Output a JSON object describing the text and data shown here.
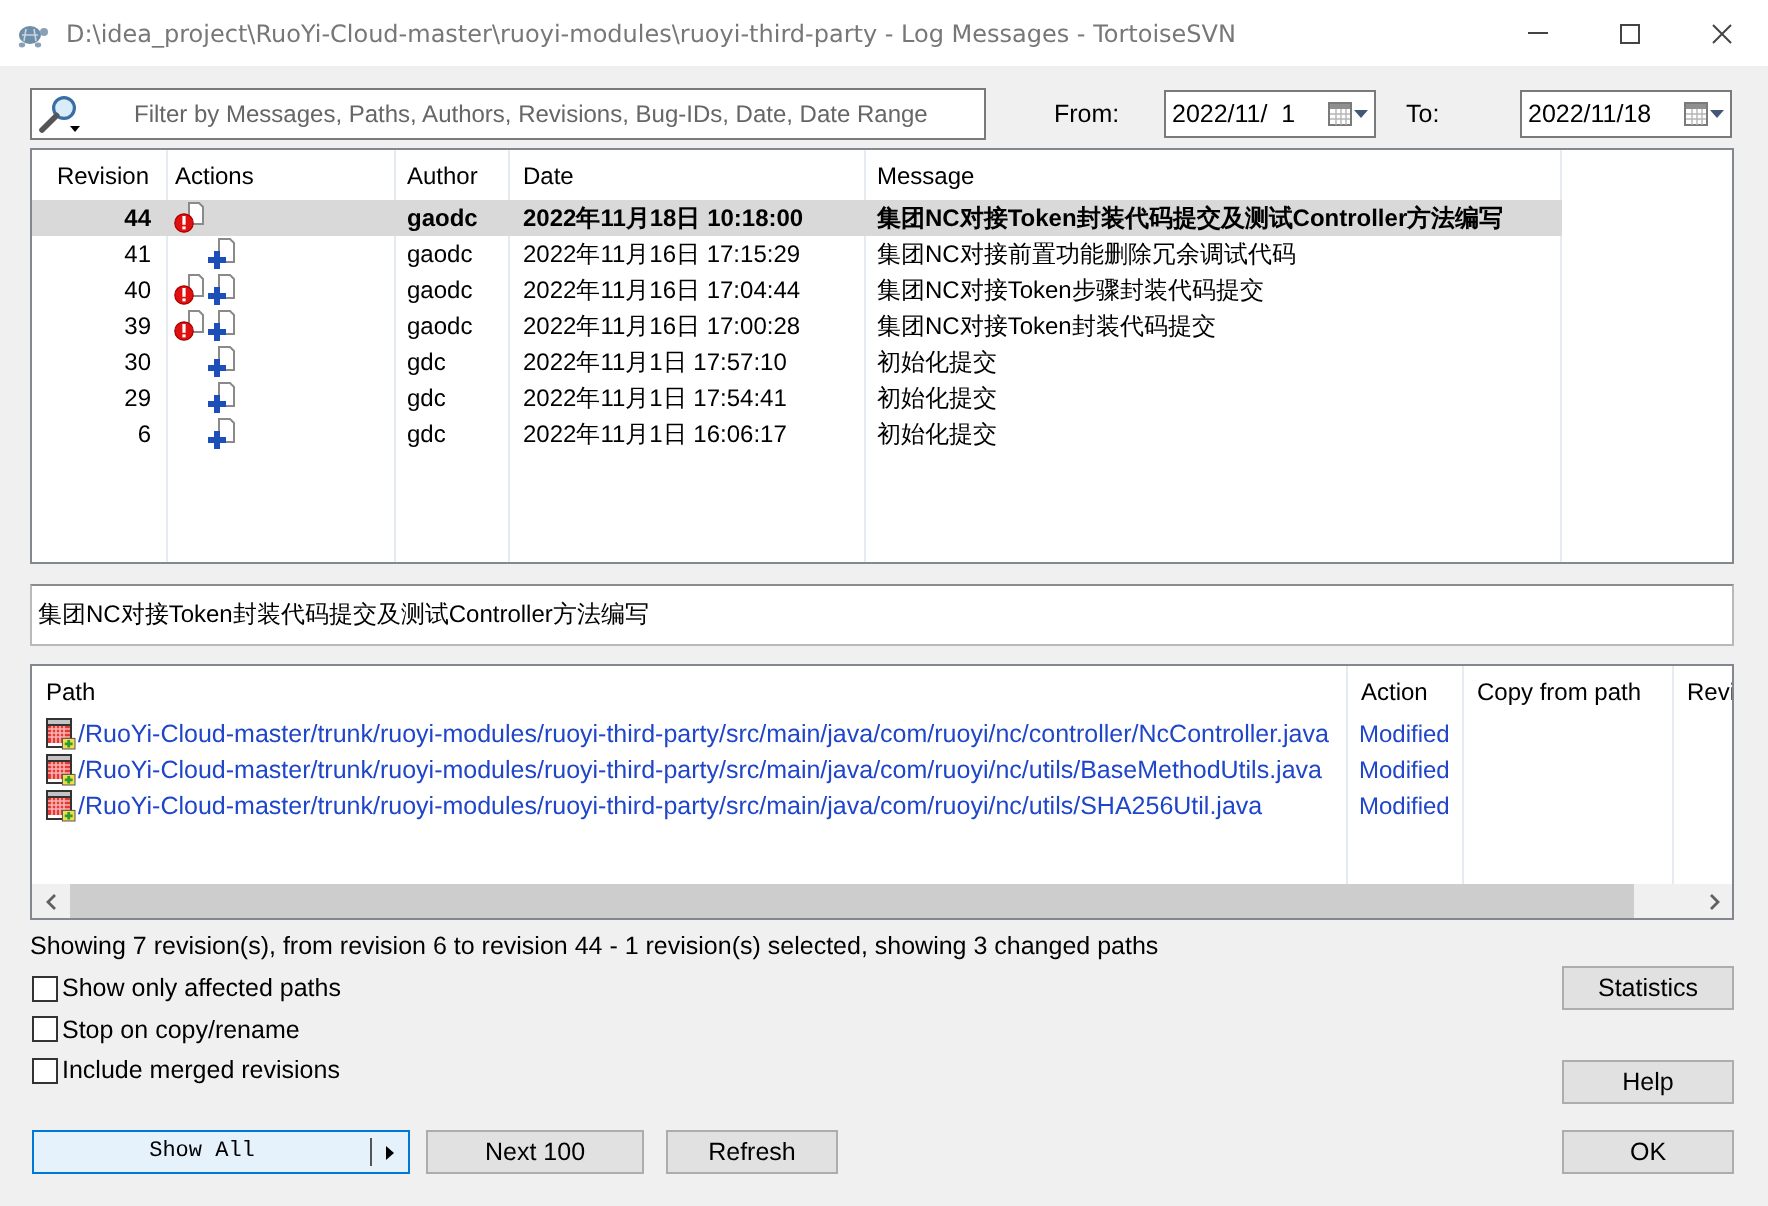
{
  "window": {
    "title": "D:\\idea_project\\RuoYi-Cloud-master\\ruoyi-modules\\ruoyi-third-party - Log Messages - TortoiseSVN"
  },
  "filter": {
    "placeholder": "Filter by Messages, Paths, Authors, Revisions, Bug-IDs, Date, Date Range",
    "from_label": "From:",
    "from_value": "2022/11/  1",
    "to_label": "To:",
    "to_value": "2022/11/18"
  },
  "log": {
    "columns": [
      "Revision",
      "Actions",
      "Author",
      "Date",
      "Message"
    ],
    "rows": [
      {
        "revision": "44",
        "actions": [
          {
            "kind": "alert"
          }
        ],
        "author": "gaodc",
        "date": "2022年11月18日 10:18:00",
        "message": "集团NC对接Token封装代码提交及测试Controller方法编写",
        "selected": true
      },
      {
        "revision": "41",
        "actions": [
          {
            "kind": "plus"
          }
        ],
        "author": "gaodc",
        "date": "2022年11月16日 17:15:29",
        "message": "集团NC对接前置功能删除冗余调试代码",
        "selected": false
      },
      {
        "revision": "40",
        "actions": [
          {
            "kind": "alert"
          },
          {
            "kind": "plus"
          }
        ],
        "author": "gaodc",
        "date": "2022年11月16日 17:04:44",
        "message": "集团NC对接Token步骤封装代码提交",
        "selected": false
      },
      {
        "revision": "39",
        "actions": [
          {
            "kind": "alert"
          },
          {
            "kind": "plus"
          }
        ],
        "author": "gaodc",
        "date": "2022年11月16日 17:00:28",
        "message": "集团NC对接Token封装代码提交",
        "selected": false
      },
      {
        "revision": "30",
        "actions": [
          {
            "kind": "plus"
          }
        ],
        "author": "gdc",
        "date": "2022年11月1日 17:57:10",
        "message": "初始化提交",
        "selected": false
      },
      {
        "revision": "29",
        "actions": [
          {
            "kind": "plus"
          }
        ],
        "author": "gdc",
        "date": "2022年11月1日 17:54:41",
        "message": "初始化提交",
        "selected": false
      },
      {
        "revision": "6",
        "actions": [
          {
            "kind": "plus"
          }
        ],
        "author": "gdc",
        "date": "2022年11月1日 16:06:17",
        "message": "初始化提交",
        "selected": false
      }
    ]
  },
  "message": "集团NC对接Token封装代码提交及测试Controller方法编写",
  "paths": {
    "columns": [
      "Path",
      "Action",
      "Copy from path",
      "Revi"
    ],
    "rows": [
      {
        "path": "/RuoYi-Cloud-master/trunk/ruoyi-modules/ruoyi-third-party/src/main/java/com/ruoyi/nc/controller/NcController.java",
        "action": "Modified"
      },
      {
        "path": "/RuoYi-Cloud-master/trunk/ruoyi-modules/ruoyi-third-party/src/main/java/com/ruoyi/nc/utils/BaseMethodUtils.java",
        "action": "Modified"
      },
      {
        "path": "/RuoYi-Cloud-master/trunk/ruoyi-modules/ruoyi-third-party/src/main/java/com/ruoyi/nc/utils/SHA256Util.java",
        "action": "Modified"
      }
    ]
  },
  "status_text": "Showing 7 revision(s), from revision 6 to revision 44 - 1 revision(s) selected, showing 3 changed paths",
  "options": [
    {
      "label": "Show only affected paths",
      "checked": false
    },
    {
      "label": "Stop on copy/rename",
      "checked": false
    },
    {
      "label": "Include merged revisions",
      "checked": false
    }
  ],
  "side_buttons": [
    {
      "label": "Statistics"
    },
    {
      "label": "Help"
    }
  ],
  "bottom_buttons": [
    {
      "label": "Show All",
      "kind": "split",
      "focused": true
    },
    {
      "label": "Next 100",
      "kind": "plain",
      "focused": false
    },
    {
      "label": "Refresh",
      "kind": "plain",
      "focused": false
    }
  ],
  "ok_button": {
    "label": "OK"
  }
}
